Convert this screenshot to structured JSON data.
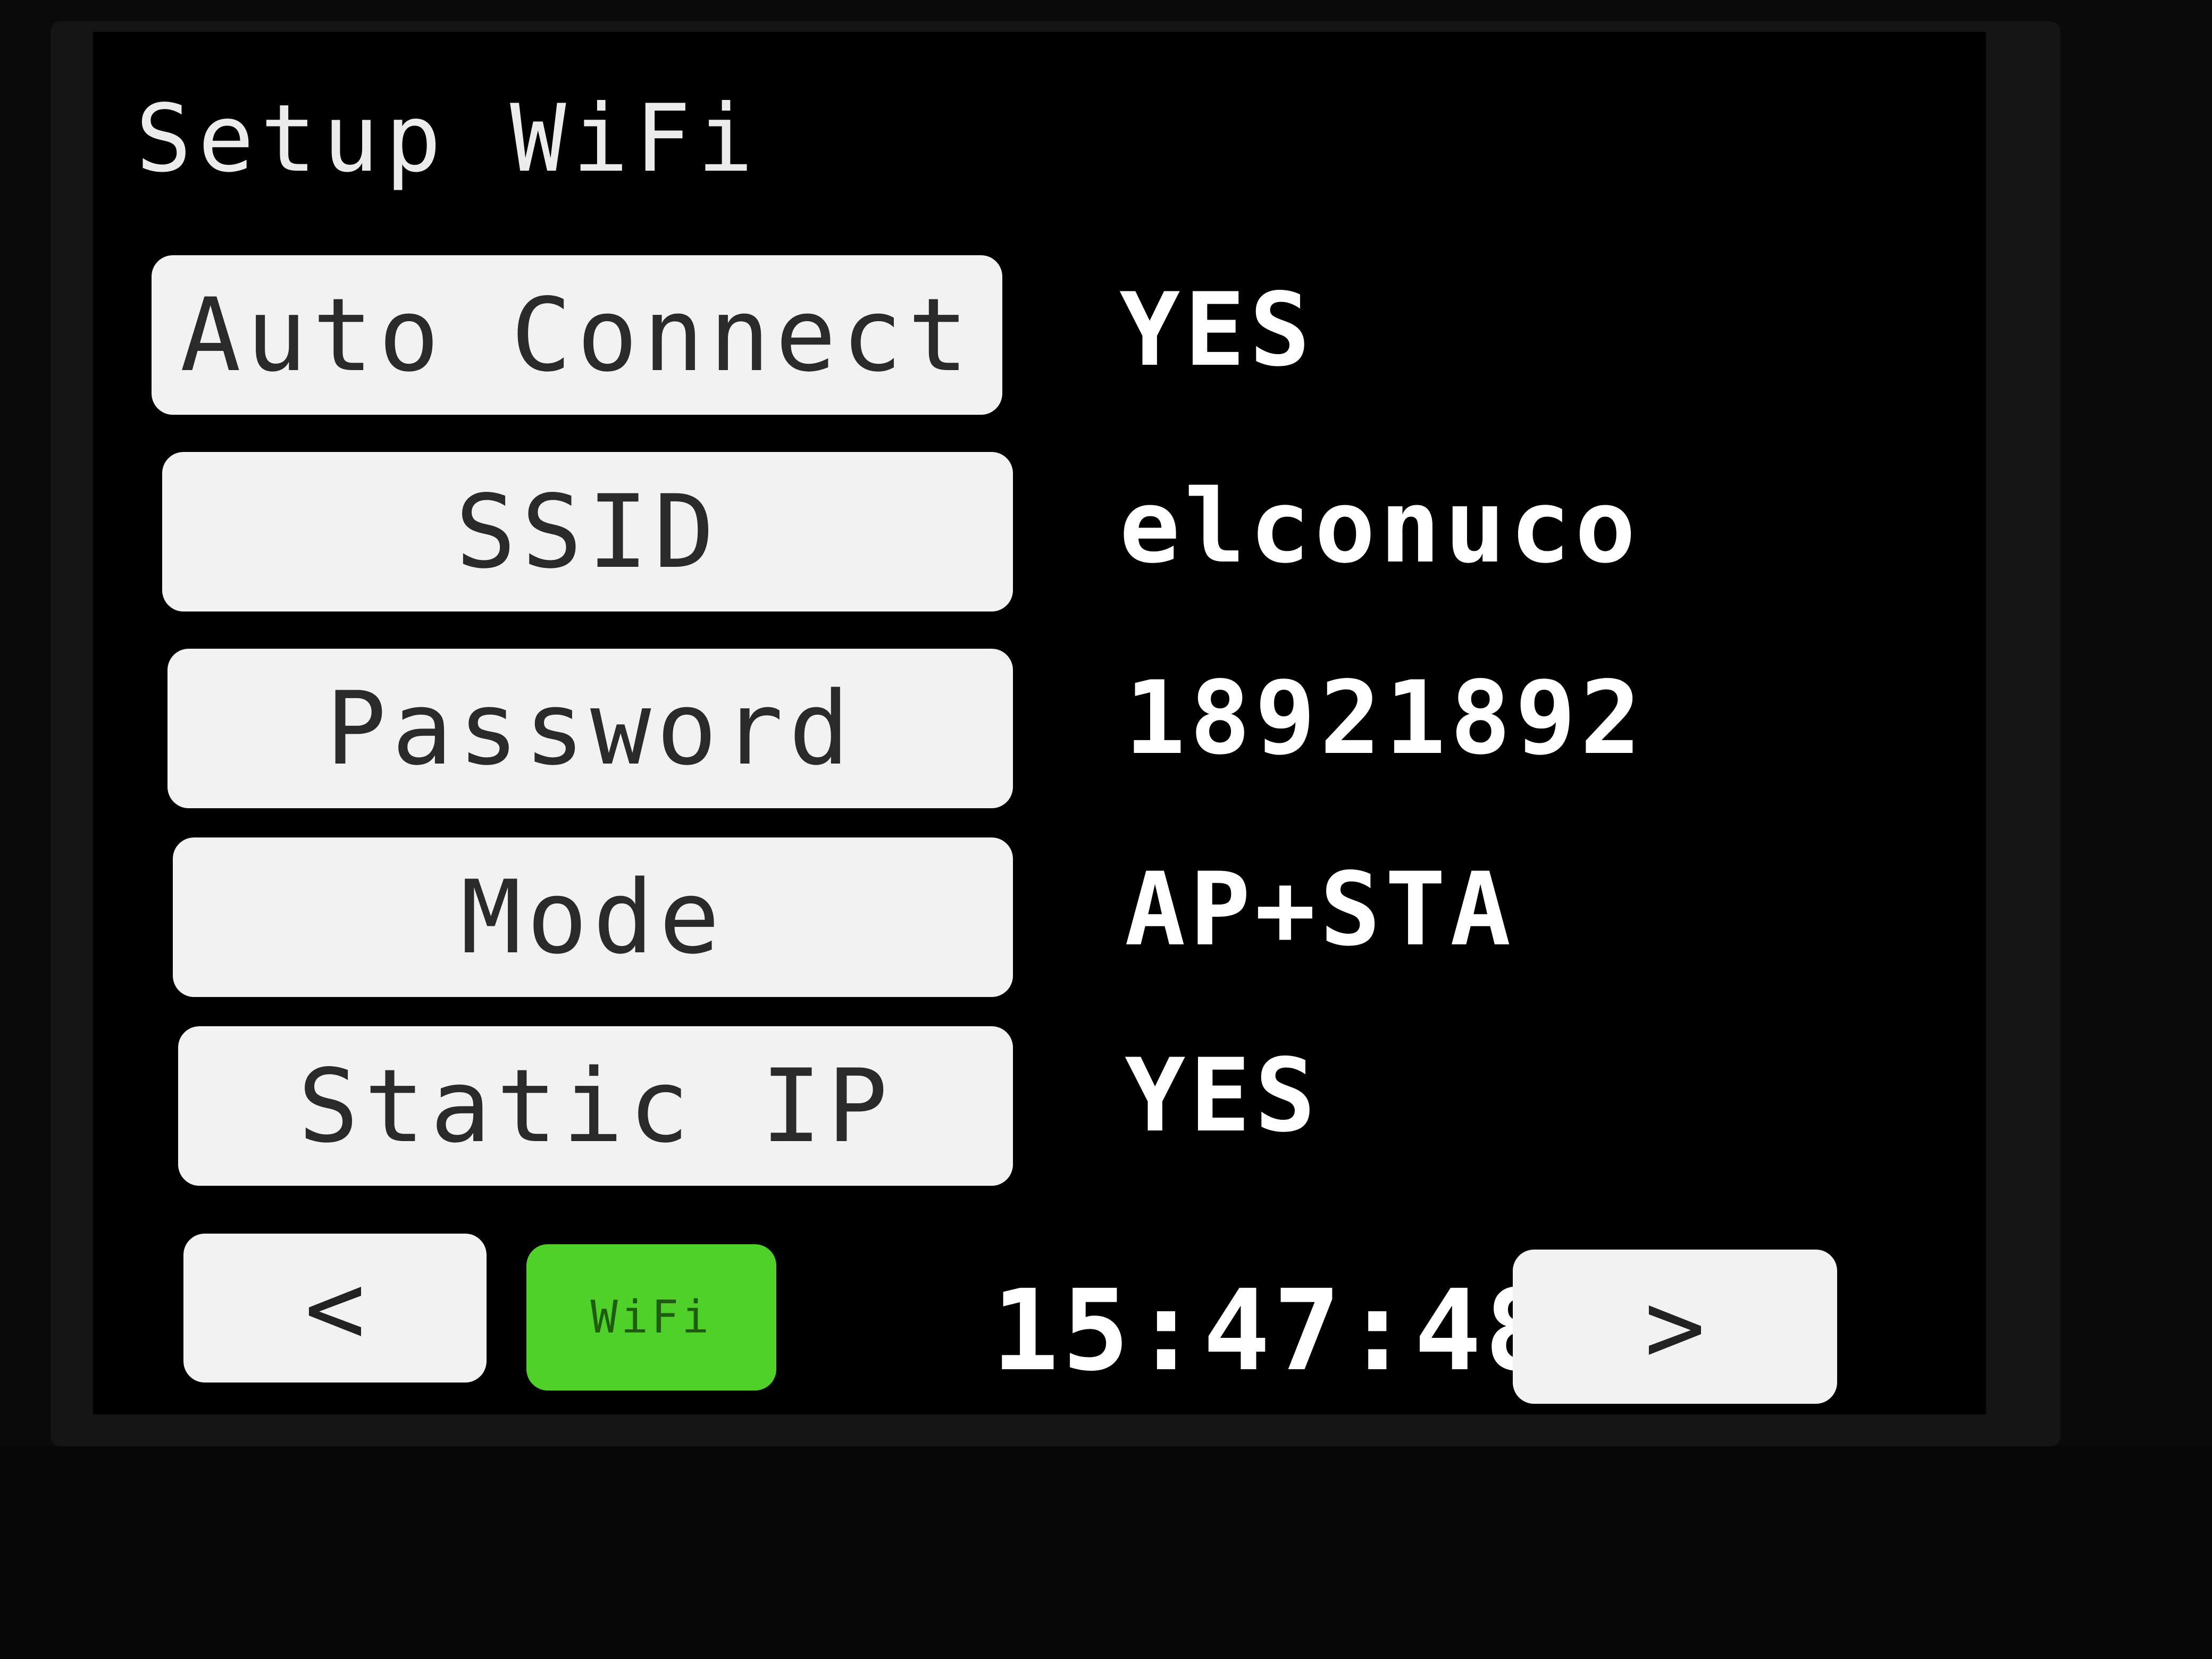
{
  "screen": {
    "title": "Setup WiFi"
  },
  "settings": [
    {
      "label": "Auto Connect",
      "value": "YES"
    },
    {
      "label": "SSID",
      "value": "elconuco"
    },
    {
      "label": "Password",
      "value": "18921892"
    },
    {
      "label": "Mode",
      "value": "AP+STA"
    },
    {
      "label": "Static IP",
      "value": "YES"
    }
  ],
  "footer": {
    "prev_label": "<",
    "wifi_label": "WiFi",
    "time": "15:47:48",
    "next_label": ">"
  },
  "colors": {
    "wifi_badge": "#4fd12a",
    "button_bg": "#f2f2f2",
    "screen_bg": "#000000"
  },
  "icons": {
    "prev": "chevron-left-icon",
    "next": "chevron-right-icon"
  }
}
